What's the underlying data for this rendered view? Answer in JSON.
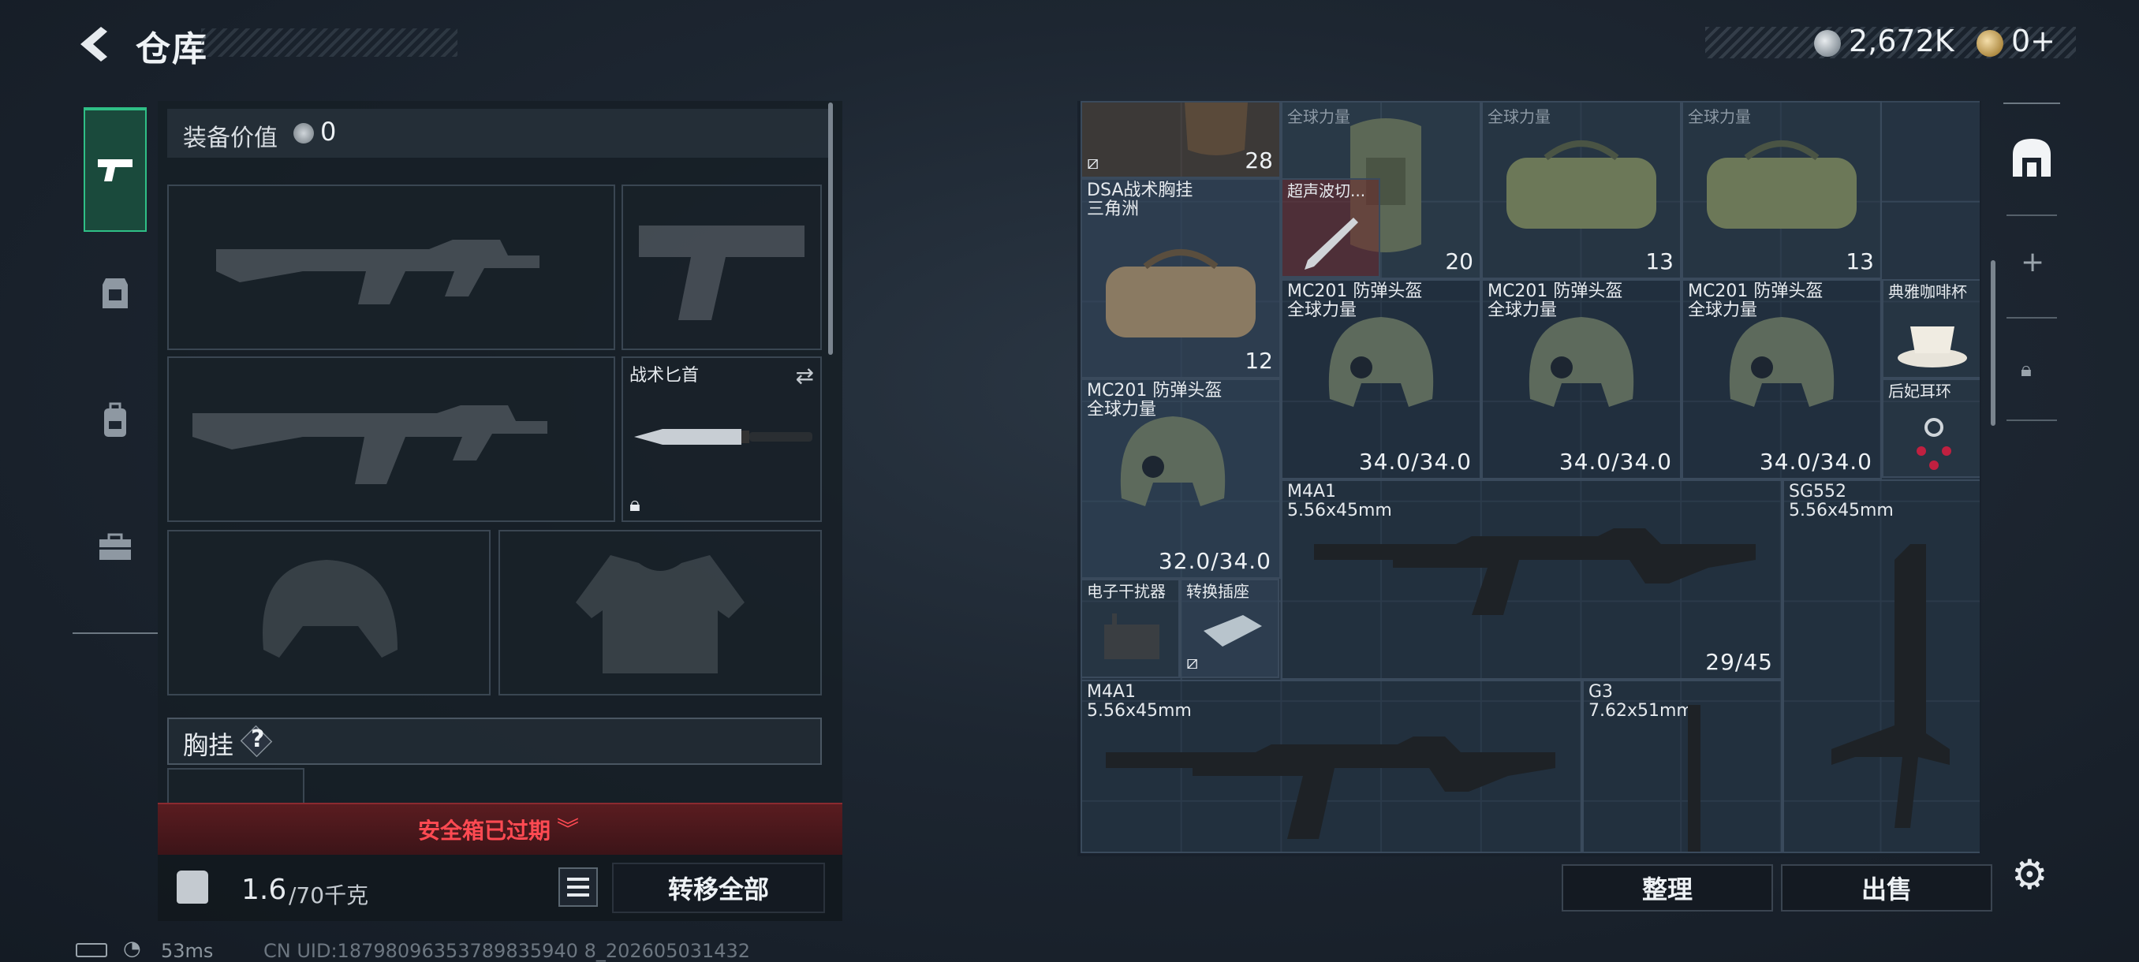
{
  "header": {
    "title": "仓库"
  },
  "currency": {
    "silver": "2,672K",
    "gold": "0+"
  },
  "loadout": {
    "equip_value_label": "装备价值",
    "equip_value": "0",
    "knife_label": "战术匕首",
    "chest_rig_label": "胸挂",
    "chest_rig_help": "?",
    "safe_box_status": "安全箱已过期",
    "weight_current": "1.6",
    "weight_max": "/70千克",
    "transfer_all": "转移全部"
  },
  "status_bar": {
    "ping": "53ms",
    "uid": "CN UID:18798096353789835940 8_202605031432"
  },
  "storage": {
    "items": [
      {
        "id": "bag1",
        "count": "28"
      },
      {
        "id": "backpack",
        "tag": "全球力量",
        "count": "20"
      },
      {
        "id": "duffel2",
        "tag": "全球力量",
        "count": "13"
      },
      {
        "id": "duffel3",
        "tag": "全球力量",
        "count": "13"
      },
      {
        "id": "dsa",
        "name": "DSA战术胸挂",
        "sub": "三角洲",
        "count": "12"
      },
      {
        "id": "ultrasonic",
        "name": "超声波切..."
      },
      {
        "id": "helmet1",
        "name": "MC201 防弹头盔",
        "sub": "全球力量",
        "dur": "34.0/34.0"
      },
      {
        "id": "helmet2",
        "name": "MC201 防弹头盔",
        "sub": "全球力量",
        "dur": "34.0/34.0"
      },
      {
        "id": "helmet3",
        "name": "MC201 防弹头盔",
        "sub": "全球力量",
        "dur": "34.0/34.0"
      },
      {
        "id": "coffee",
        "name": "典雅咖啡杯"
      },
      {
        "id": "earring",
        "name": "后妃耳环"
      },
      {
        "id": "helmet4",
        "name": "MC201 防弹头盔",
        "sub": "全球力量",
        "dur": "32.0/34.0"
      },
      {
        "id": "m4a1a",
        "name": "M4A1",
        "sub": "5.56x45mm",
        "dur": "29/45"
      },
      {
        "id": "sg552",
        "name": "SG552",
        "sub": "5.56x45mm"
      },
      {
        "id": "jammer",
        "name": "电子干扰器"
      },
      {
        "id": "adapter",
        "name": "转换插座"
      },
      {
        "id": "m4a1b",
        "name": "M4A1",
        "sub": "5.56x45mm"
      },
      {
        "id": "g3",
        "name": "G3",
        "sub": "7.62x51mm"
      }
    ],
    "sort_label": "整理",
    "sell_label": "出售"
  },
  "icons": {
    "back": "back-arrow-icon",
    "weapons_tab": "pistol-icon",
    "settings": "gear-icon"
  },
  "colors": {
    "accent_green": "#2fbf86",
    "alert_red": "#ff4a52"
  }
}
